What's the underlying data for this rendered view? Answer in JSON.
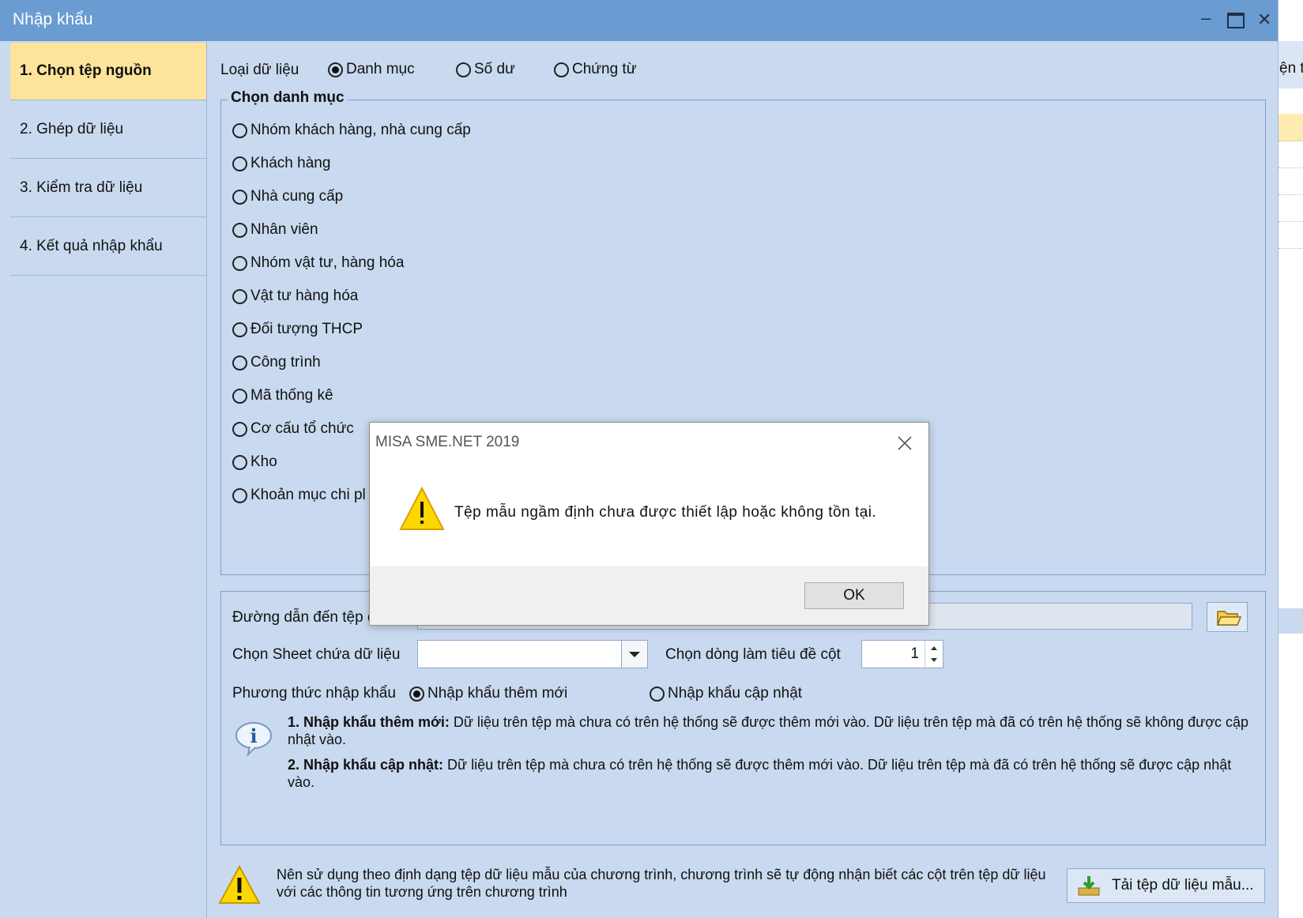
{
  "window": {
    "title": "Nhập khẩu",
    "minimize_glyph": "–",
    "maximize_glyph": "▭",
    "close_glyph": "✕"
  },
  "background_app": {
    "header_text": "ện t"
  },
  "steps": [
    {
      "label": "1. Chọn tệp nguồn",
      "active": true
    },
    {
      "label": "2. Ghép dữ liệu",
      "active": false
    },
    {
      "label": "3. Kiểm tra dữ liệu",
      "active": false
    },
    {
      "label": "4. Kết quả nhập khẩu",
      "active": false
    }
  ],
  "data_type": {
    "label": "Loại dữ liệu",
    "options": [
      {
        "label": "Danh mục",
        "selected": true
      },
      {
        "label": "Số dư",
        "selected": false
      },
      {
        "label": "Chứng từ",
        "selected": false
      }
    ]
  },
  "catalog": {
    "legend": "Chọn danh mục",
    "items": [
      "Nhóm khách hàng, nhà cung cấp",
      "Khách hàng",
      "Nhà cung cấp",
      "Nhân viên",
      "Nhóm vật tư, hàng hóa",
      "Vật tư hàng hóa",
      "Đối tượng THCP",
      "Công trình",
      "Mã thống kê",
      "Cơ cấu tổ chức",
      "Kho",
      "Khoản mục chi pl"
    ]
  },
  "source": {
    "path_label": "Đường dẫn đến tệp d",
    "path_value": "",
    "sheet_label": "Chọn Sheet chứa dữ liệu",
    "sheet_value": "",
    "header_row_label": "Chọn dòng làm tiêu đề cột",
    "header_row_value": "1",
    "method_label": "Phương thức nhập khẩu",
    "methods": [
      {
        "label": "Nhập khẩu thêm mới",
        "selected": true
      },
      {
        "label": "Nhập khẩu cập nhật",
        "selected": false
      }
    ],
    "note1_bold": "1. Nhập khẩu thêm mới:",
    "note1_text": " Dữ liệu trên tệp mà chưa có trên hệ thống sẽ được thêm mới vào. Dữ liệu trên tệp mà đã có trên hệ thống sẽ không được cập nhật vào.",
    "note2_bold": "2. Nhập khẩu cập nhật:",
    "note2_text": " Dữ liệu trên tệp mà chưa có trên hệ thống sẽ được thêm mới vào. Dữ liệu trên tệp mà đã có trên hệ thống sẽ được cập nhật vào."
  },
  "footer": {
    "warning_text": "Nên sử dụng theo định dạng tệp dữ liệu mẫu của chương trình, chương trình sẽ tự động nhận biết các cột trên tệp dữ liệu với các thông tin tương ứng trên chương trình",
    "download_label": "Tải tệp dữ liệu mẫu..."
  },
  "dialog": {
    "title": "MISA SME.NET 2019",
    "message": "Tệp mẫu ngầm định chưa được thiết lập hoặc không tồn tại.",
    "ok_label": "OK"
  },
  "colors": {
    "titlebar": "#6a9bd1",
    "panel": "#c9d9ef",
    "active_step": "#fde49a",
    "warning_yellow": "#ffd700"
  }
}
